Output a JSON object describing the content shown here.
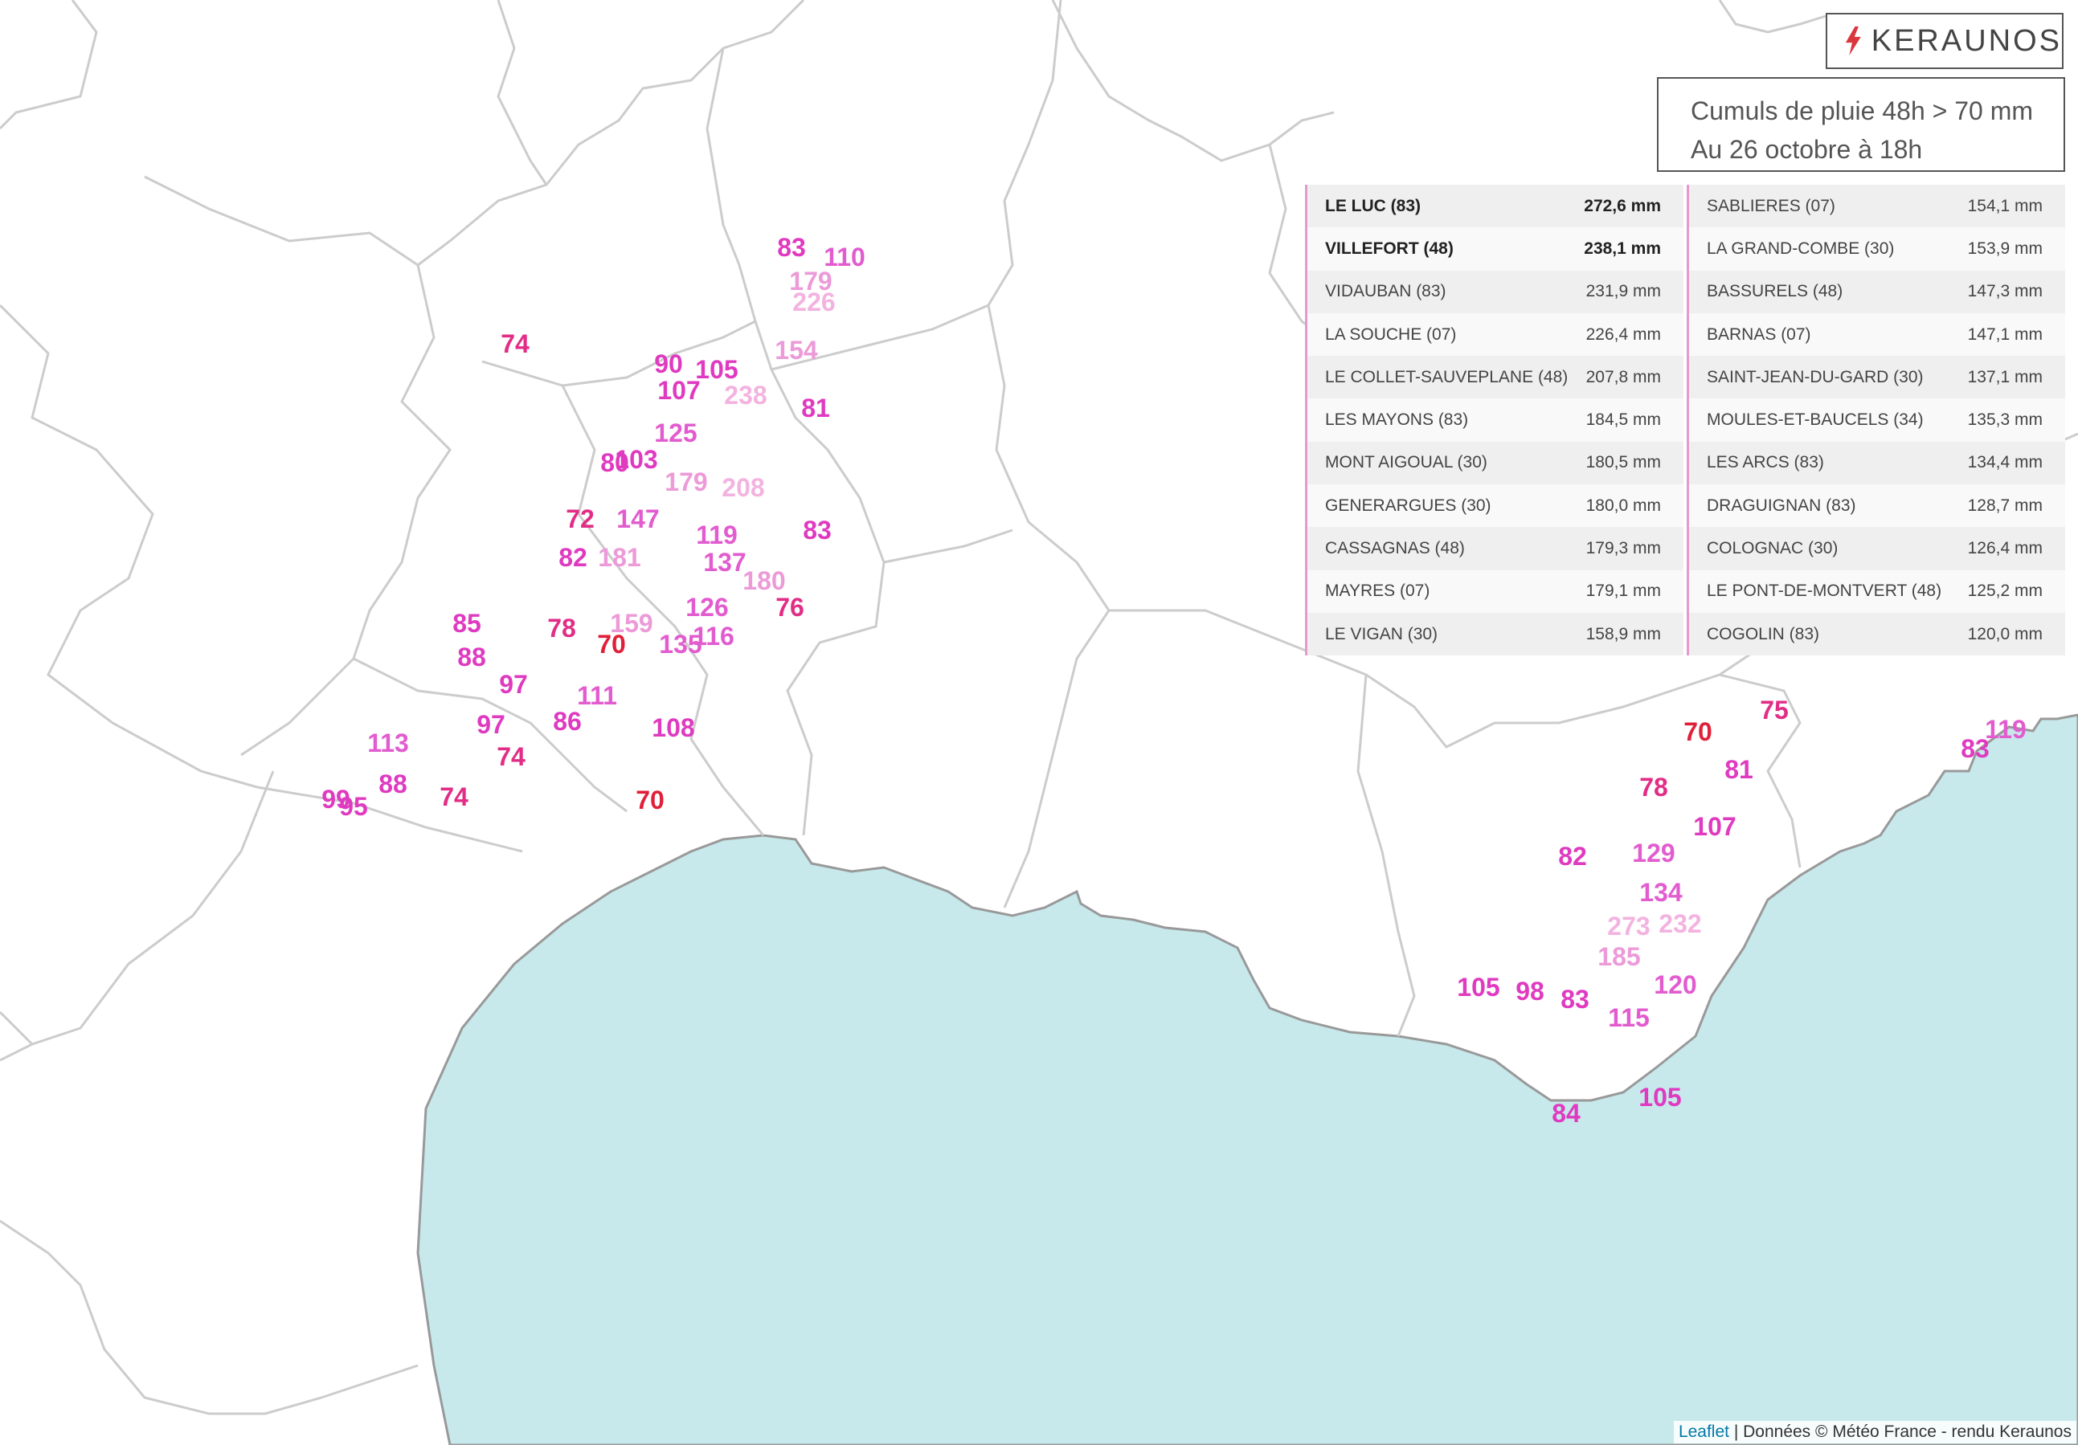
{
  "logo": {
    "text": "KERAUNOS",
    "icon": "lightning-bolt-icon",
    "accent": "#d9363e"
  },
  "title": {
    "line1": "Cumuls de pluie 48h > 70 mm",
    "line2": "Au 26 octobre à 18h"
  },
  "colors": {
    "sea": "#c7e9ec",
    "land": "#ffffff",
    "border": "#cccccc",
    "coast": "#999999"
  },
  "table": {
    "left": [
      {
        "name": "LE LUC (83)",
        "value": "272,6 mm",
        "bold": true
      },
      {
        "name": "VILLEFORT (48)",
        "value": "238,1 mm",
        "bold": true
      },
      {
        "name": "VIDAUBAN (83)",
        "value": "231,9 mm"
      },
      {
        "name": "LA SOUCHE (07)",
        "value": "226,4 mm"
      },
      {
        "name": "LE COLLET-SAUVEPLANE (48)",
        "value": "207,8 mm"
      },
      {
        "name": "LES MAYONS (83)",
        "value": "184,5 mm"
      },
      {
        "name": "MONT AIGOUAL (30)",
        "value": "180,5 mm"
      },
      {
        "name": "GENERARGUES (30)",
        "value": "180,0 mm"
      },
      {
        "name": "CASSAGNAS (48)",
        "value": "179,3 mm"
      },
      {
        "name": "MAYRES (07)",
        "value": "179,1 mm"
      },
      {
        "name": "LE VIGAN (30)",
        "value": "158,9 mm"
      }
    ],
    "right": [
      {
        "name": "SABLIERES (07)",
        "value": "154,1 mm"
      },
      {
        "name": "LA GRAND-COMBE (30)",
        "value": "153,9 mm"
      },
      {
        "name": "BASSURELS (48)",
        "value": "147,3 mm"
      },
      {
        "name": "BARNAS (07)",
        "value": "147,1 mm"
      },
      {
        "name": "SAINT-JEAN-DU-GARD (30)",
        "value": "137,1 mm"
      },
      {
        "name": "MOULES-ET-BAUCELS (34)",
        "value": "135,3 mm"
      },
      {
        "name": "LES ARCS (83)",
        "value": "134,4 mm"
      },
      {
        "name": "DRAGUIGNAN (83)",
        "value": "128,7 mm"
      },
      {
        "name": "COLOGNAC (30)",
        "value": "126,4 mm"
      },
      {
        "name": "LE PONT-DE-MONTVERT (48)",
        "value": "125,2 mm"
      },
      {
        "name": "COGOLIN (83)",
        "value": "120,0 mm"
      }
    ]
  },
  "stations": [
    "83",
    "110",
    "179",
    "226",
    "74",
    "90",
    "105",
    "154",
    "107",
    "238",
    "81",
    "125",
    "80",
    "103",
    "179",
    "208",
    "72",
    "147",
    "83",
    "119",
    "82",
    "181",
    "137",
    "180",
    "126",
    "76",
    "85",
    "78",
    "159",
    "116",
    "70",
    "135",
    "88",
    "97",
    "111",
    "97",
    "86",
    "108",
    "113",
    "74",
    "99",
    "95",
    "88",
    "74",
    "70",
    "75",
    "70",
    "119",
    "83",
    "81",
    "78",
    "107",
    "82",
    "129",
    "134",
    "273",
    "232",
    "185",
    "105",
    "120",
    "98",
    "83",
    "115",
    "84",
    "105"
  ],
  "attribution": {
    "link": "Leaflet",
    "text": " | Données © Météo France - rendu Keraunos"
  }
}
